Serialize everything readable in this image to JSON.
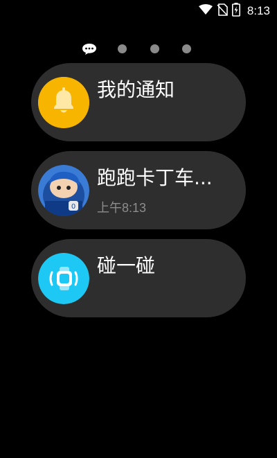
{
  "status_bar": {
    "time": "8:13",
    "icons": [
      "wifi-icon",
      "no-sim-icon",
      "battery-charging-icon"
    ]
  },
  "page_indicator": {
    "pages": 4,
    "current_icon": "chat-bubble-icon"
  },
  "cards": [
    {
      "title": "我的通知",
      "subtitle": "",
      "icon": "bell-icon"
    },
    {
      "title": "跑跑卡丁车...",
      "subtitle": "上午8:13",
      "icon": "game-avatar-icon"
    },
    {
      "title": "碰一碰",
      "subtitle": "",
      "icon": "watch-tap-icon"
    }
  ],
  "colors": {
    "background": "#000000",
    "card": "#2e2e2e",
    "bell_bg": "#f5b400",
    "watch_bg": "#1ec8f5"
  }
}
